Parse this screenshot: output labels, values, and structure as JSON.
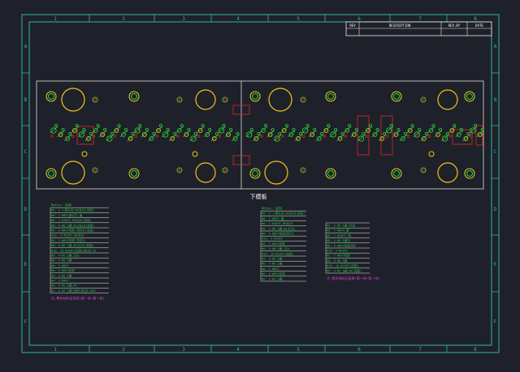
{
  "colors": {
    "background": "#1e2129",
    "frame": "#2fb5a8",
    "plate": "#c8c8c8",
    "circle_large": "#f2c21c",
    "circle_green": "#2fd23c",
    "circle_small_outer": "#e6d21e",
    "red": "#e0282a",
    "note_text": "#1ec83c",
    "note_line": "#e8e8e8",
    "magenta": "#e040e0",
    "white": "#ffffff"
  },
  "frame": {
    "column_labels": [
      "1",
      "2",
      "3",
      "4",
      "5",
      "6",
      "7",
      "8"
    ],
    "row_labels": [
      "A",
      "B",
      "C",
      "D",
      "E",
      "F"
    ]
  },
  "title_block": {
    "headers": [
      "REV",
      "DESCRIPTION",
      "REV.BY",
      "DATE"
    ]
  },
  "drawing": {
    "caption": "下模板"
  },
  "notes_left": {
    "heading": "Notes: 说明",
    "lines": [
      "Φ5: 3-一般孔径,M6深20(背面)",
      "Φ8: 2-Φ8H7销钉孔,通",
      "Φ6: 2-Φ10H7,M8深20(背面)",
      "Φ8: 4-Φ8.5通,Φ13深10(背面)",
      "Φ6: 6-Φ6H7线割,顶杆孔(背面)",
      "Φ10: 4-Φ10H7,M8深20",
      "Φ5: 2-Φ6H7线割,导柱孔",
      "Φ8: 8-Φ8.5通,Φ13沉头(背面)",
      "Φ10: 10-Φ10H7(线割)单边0.01",
      "Φ5: 4-Φ5.5通,沉头",
      "Φ6: 4-Φ6.5通",
      "Φ8: 2-Φ8H7",
      "Φ6: 6-Φ6H7线割",
      "Φ5: 3-Φ5.5通",
      "Φ4: 2-Φ4H7",
      "Φ3: 4-Φ3.5通,M4",
      "Φ2: 6-Φ2.1通(线割)单边0.005"
    ],
    "footer": "注:零件材料见清单(第一张~第一张)"
  },
  "notes_right_a": {
    "heading": "Notes: 说明",
    "lines": [
      "Φ5: 3-一般孔径,M6深20(背面)",
      "Φ8: 2-Φ8H7,通",
      "Φ6: 2-Φ10H7,M8深20",
      "Φ8: 4-Φ8.5通,Φ13沉头",
      "Φ6: 6-Φ6H7线割顶杆孔",
      "Φ10: 4-Φ10H7",
      "Φ5: 2-Φ6H7线割",
      "Φ8: 8-Φ8.5通,沉头",
      "Φ10: 10-Φ10H7(线割)",
      "Φ5: 4-Φ5.5通",
      "Φ6: 4-Φ6.5通",
      "Φ8: 2-Φ8H7",
      "Φ6: 6-Φ6H7线割",
      "Φ5: 3-Φ5.5通"
    ]
  },
  "notes_right_b": {
    "lines": [
      "Φ5: 3-Φ5.5通,M6背",
      "Φ8: 2-Φ8H7,通",
      "Φ6: 2-Φ10H7,M8",
      "Φ8: 4-Φ8.5通沉",
      "Φ6: 6-Φ6H7线割顶杆",
      "Φ10: 4-Φ10H7",
      "Φ5: 2-Φ6H7线割",
      "Φ8: 8-Φ8.5通",
      "Φ10: 10-Φ10H7(线割)",
      "Φ5: 4-Φ5.5通,M4(背面)"
    ],
    "footer": "注:零件材料见清单(第一张~第一张)"
  }
}
